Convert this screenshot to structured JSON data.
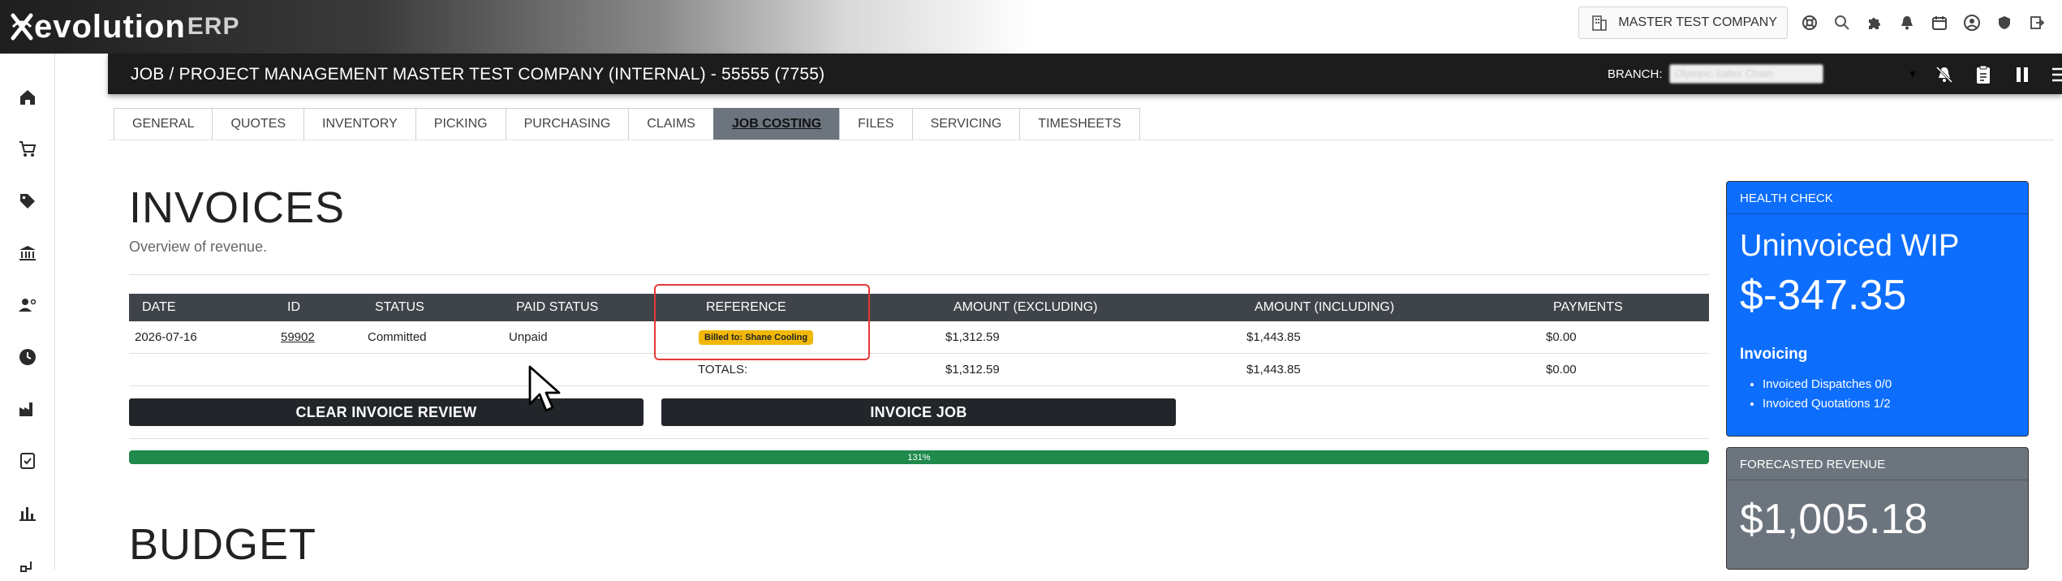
{
  "app": {
    "logo_evo": "evolution",
    "logo_erp": "ERP",
    "company": "MASTER TEST COMPANY"
  },
  "header": {
    "title": "JOB / PROJECT MANAGEMENT MASTER TEST COMPANY (INTERNAL) - 55555 (7755)",
    "branch_label": "BRANCH:",
    "branch_value": "Olympic Sales Chain"
  },
  "tabs": [
    {
      "label": "GENERAL"
    },
    {
      "label": "QUOTES"
    },
    {
      "label": "INVENTORY"
    },
    {
      "label": "PICKING"
    },
    {
      "label": "PURCHASING"
    },
    {
      "label": "CLAIMS"
    },
    {
      "label": "JOB COSTING"
    },
    {
      "label": "FILES"
    },
    {
      "label": "SERVICING"
    },
    {
      "label": "TIMESHEETS"
    }
  ],
  "invoices": {
    "title": "INVOICES",
    "subtitle": "Overview of revenue.",
    "columns": [
      "DATE",
      "ID",
      "STATUS",
      "PAID STATUS",
      "REFERENCE",
      "AMOUNT (EXCLUDING)",
      "AMOUNT (INCLUDING)",
      "PAYMENTS"
    ],
    "rows": [
      {
        "date": "2026-07-16",
        "id": "59902",
        "status": "Committed",
        "paid_status": "Unpaid",
        "reference": "Billed to: Shane Cooling",
        "amount_ex": "$1,312.59",
        "amount_inc": "$1,443.85",
        "payments": "$0.00"
      }
    ],
    "totals": {
      "label": "TOTALS:",
      "amount_ex": "$1,312.59",
      "amount_inc": "$1,443.85",
      "payments": "$0.00"
    },
    "clear_button": "CLEAR INVOICE REVIEW",
    "invoice_button": "INVOICE JOB",
    "progress_percent": 131,
    "progress_label": "131%"
  },
  "budget": {
    "title": "BUDGET"
  },
  "health_check": {
    "header": "HEALTH CHECK",
    "label": "Uninvoiced WIP",
    "value": "$-347.35",
    "invoicing_title": "Invoicing",
    "items": [
      "Invoiced Dispatches 0/0",
      "Invoiced Quotations 1/2"
    ]
  },
  "forecast": {
    "header": "FORECASTED REVENUE",
    "value": "$1,005.18"
  },
  "colors": {
    "primary": "#0d6efd",
    "dark": "#22262a",
    "secondary": "#6c757d",
    "success": "#1f8a4c",
    "warning": "#f1b80a",
    "highlight": "#e53935"
  }
}
